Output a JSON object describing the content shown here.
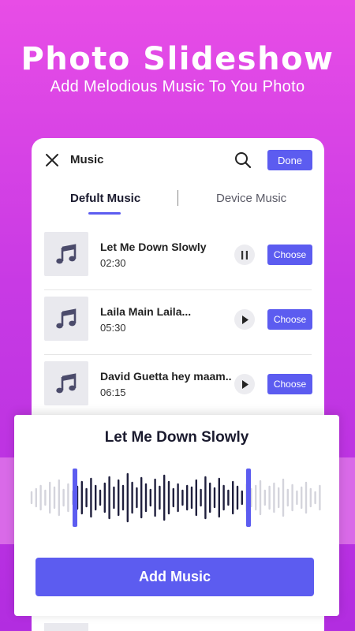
{
  "hero": {
    "title": "Photo Slideshow",
    "subtitle": "Add Melodious Music To You Photo"
  },
  "header": {
    "title": "Music",
    "done_label": "Done",
    "close_icon": "close-icon",
    "search_icon": "search-icon"
  },
  "tabs": [
    {
      "label": "Defult Music",
      "active": true
    },
    {
      "label": "Device Music",
      "active": false
    }
  ],
  "songs": [
    {
      "name": "Let Me Down Slowly",
      "duration": "02:30",
      "state": "playing",
      "choose_label": "Choose"
    },
    {
      "name": "Laila Main Laila...",
      "duration": "05:30",
      "state": "paused",
      "choose_label": "Choose"
    },
    {
      "name": "David Guetta hey maam..",
      "duration": "06:15",
      "state": "paused",
      "choose_label": "Choose"
    }
  ],
  "player": {
    "title": "Let Me Down Slowly",
    "add_label": "Add Music"
  },
  "colors": {
    "accent": "#5c5cf0",
    "wave_active": "#1f1f3d",
    "wave_inactive": "#d4d4dc",
    "bg_top": "#e84de6",
    "bg_bottom": "#b22de0"
  }
}
